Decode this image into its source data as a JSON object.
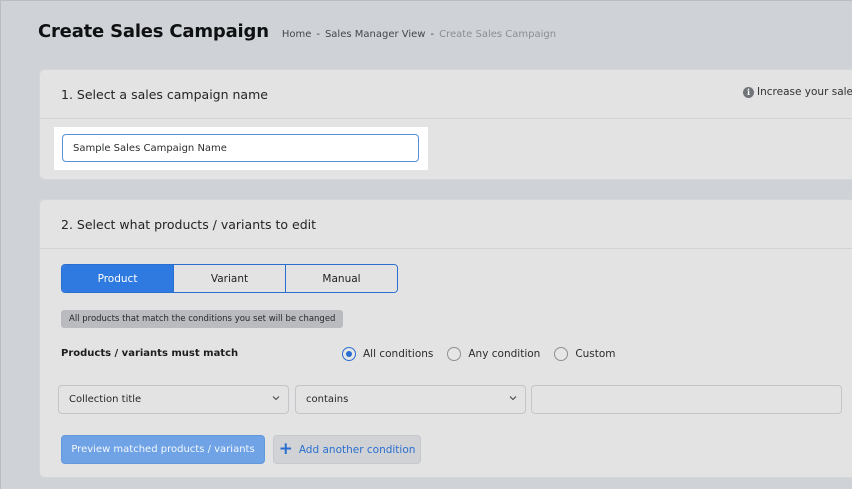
{
  "header": {
    "title": "Create Sales Campaign",
    "breadcrumb": [
      "Home",
      "Sales Manager View",
      "Create Sales Campaign"
    ],
    "separator": "-"
  },
  "section1": {
    "title": "1. Select a sales campaign name",
    "info_text": "Increase your sales",
    "info_icon": "info-icon",
    "name_input_value": "Sample Sales Campaign Name"
  },
  "section2": {
    "title": "2. Select what products / variants to edit",
    "tabs": [
      {
        "label": "Product",
        "active": true
      },
      {
        "label": "Variant",
        "active": false
      },
      {
        "label": "Manual",
        "active": false
      }
    ],
    "note": "All products that match the conditions you set will be changed",
    "match_label": "Products / variants must match",
    "match_options": [
      {
        "label": "All conditions",
        "checked": true
      },
      {
        "label": "Any condition",
        "checked": false
      },
      {
        "label": "Custom",
        "checked": false
      }
    ],
    "condition": {
      "field": "Collection title",
      "operator": "contains",
      "value": ""
    },
    "preview_button": "Preview matched products / variants",
    "add_condition_button": "Add another condition"
  },
  "colors": {
    "accent": "#2e7ae0",
    "background": "#cfd2d6",
    "card": "#e3e3e3"
  }
}
